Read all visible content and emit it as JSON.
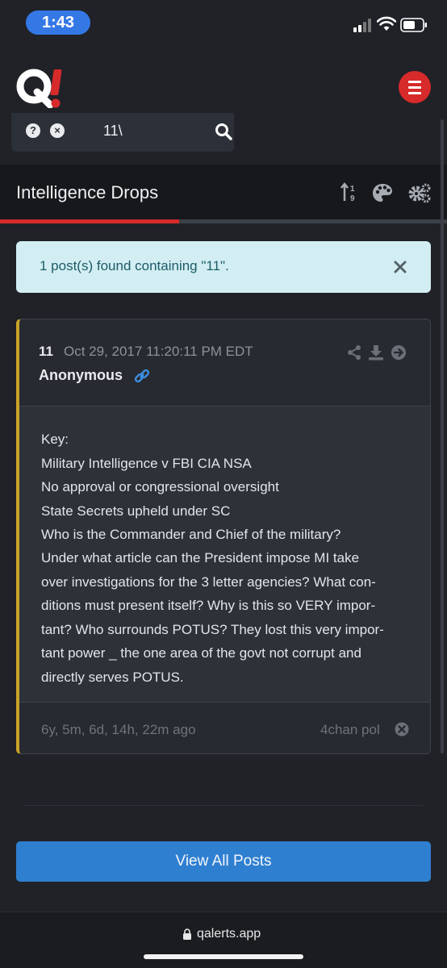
{
  "status_bar": {
    "time": "1:43"
  },
  "search": {
    "value": "11\\"
  },
  "title_bar": {
    "title": "Intelligence Drops"
  },
  "progress": {
    "fraction": 0.4
  },
  "alert": {
    "text": "1 post(s) found containing \"11\"."
  },
  "post": {
    "number": "11",
    "date": "Oct 29, 2017 11:20:11 PM EDT",
    "author": "Anonymous",
    "lines": [
      "Key:",
      "Military Intelligence v FBI CIA NSA",
      "No approval or congressional oversight",
      "State Secrets upheld under SC",
      "Who is the Commander and Chief of the military?",
      "Under what article can the President impose MI take",
      "over investigations for the 3 letter agencies? What con-",
      "ditions must present itself? Why is this so VERY impor-",
      "tant? Who surrounds POTUS? They lost this very impor-",
      "tant power _ the one area of the govt not corrupt and",
      "directly serves POTUS."
    ],
    "ago": "6y, 5m, 6d, 14h, 22m ago",
    "source": "4chan pol"
  },
  "view_all_label": "View All Posts",
  "url_bar": {
    "url": "qalerts.app"
  },
  "colors": {
    "brand_red": "#d72a2a",
    "accent_blue": "#2f7fd0",
    "card_border": "#c9a227",
    "alert_bg": "#d2eef3"
  },
  "icons": [
    "signal-icon",
    "wifi-icon",
    "battery-icon",
    "q-logo",
    "hamburger-menu-icon",
    "help-icon",
    "clear-icon",
    "search-icon",
    "sort-icon",
    "palette-icon",
    "settings-icon",
    "close-icon",
    "link-icon",
    "share-icon",
    "download-icon",
    "goto-icon",
    "remove-icon",
    "lock-icon"
  ]
}
